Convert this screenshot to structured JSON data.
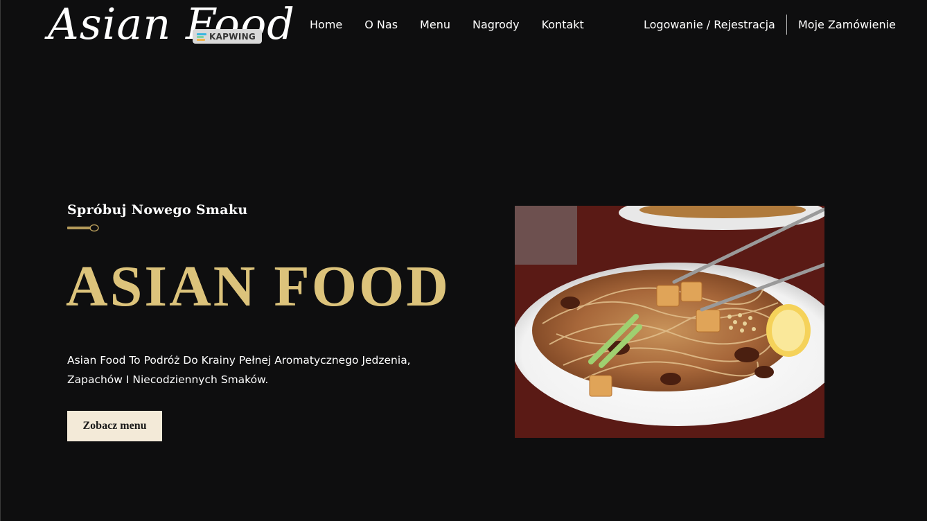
{
  "header": {
    "logo_text": "Asian Food",
    "watermark_text": "KAPWING",
    "nav": [
      "Home",
      "O Nas",
      "Menu",
      "Nagrody",
      "Kontakt"
    ],
    "auth_label": "Logowanie / Rejestracja",
    "orders_label": "Moje Zamówienie"
  },
  "hero": {
    "tagline": "Spróbuj Nowego Smaku",
    "title": "ASIAN FOOD",
    "description": "Asian Food To Podróż Do Krainy Pełnej Aromatycznego Jedzenia, Zapachów I Niecodziennych Smaków.",
    "cta_label": "Zobacz menu",
    "image_subject": "noodle-dish-photo"
  },
  "colors": {
    "background": "#0e0e0f",
    "accent_gold": "#dcc37b",
    "button_bg": "#f3ead8",
    "text": "#ffffff"
  }
}
